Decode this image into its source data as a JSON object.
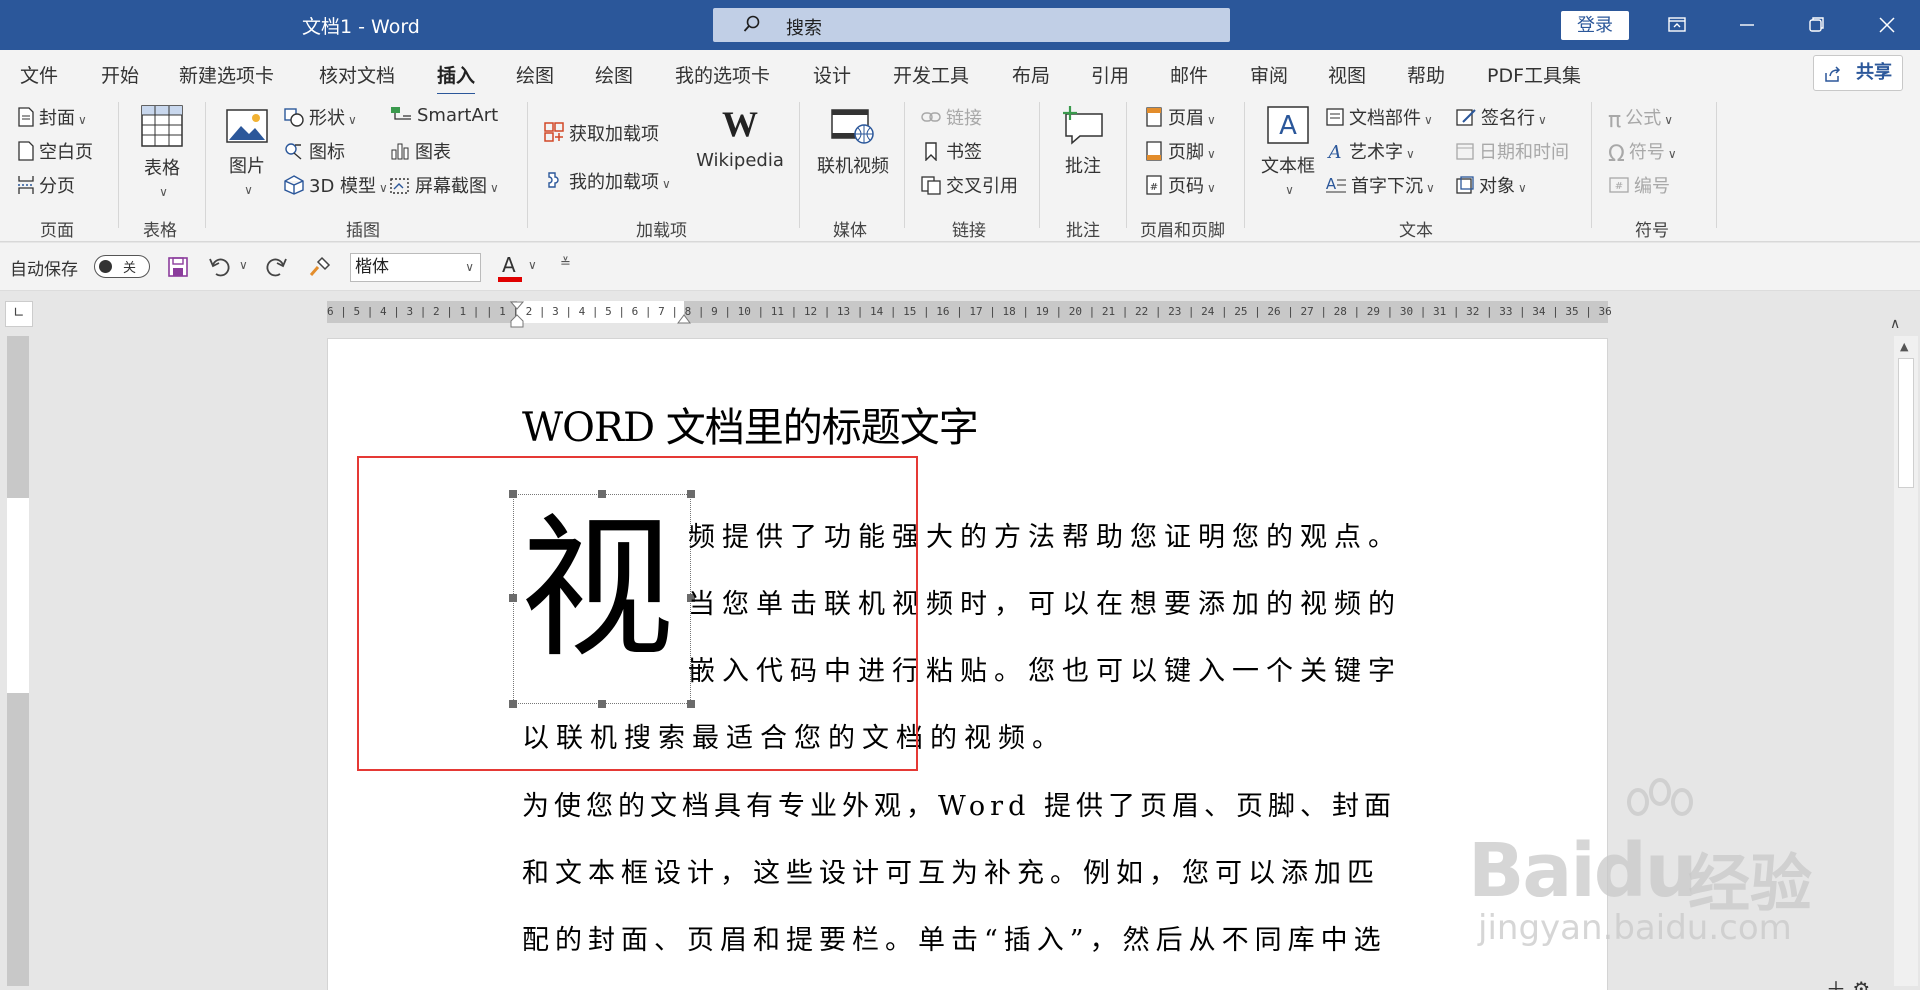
{
  "window": {
    "title": "文档1  -  Word",
    "search_placeholder": "搜索",
    "login_label": "登录"
  },
  "tabs": [
    "文件",
    "开始",
    "新建选项卡",
    "核对文档",
    "插入",
    "绘图",
    "绘图",
    "我的选项卡",
    "设计",
    "开发工具",
    "布局",
    "引用",
    "邮件",
    "审阅",
    "视图",
    "帮助",
    "PDF工具集"
  ],
  "active_tab": "插入",
  "share_label": "共享",
  "ribbon": {
    "page": {
      "cover": "封面",
      "blank": "空白页",
      "break": "分页",
      "label": "页面"
    },
    "table": {
      "btn": "表格",
      "label": "表格"
    },
    "illustrations": {
      "picture": "图片",
      "shapes": "形状",
      "icons": "图标",
      "model3d": "3D 模型",
      "smartart": "SmartArt",
      "chart": "图表",
      "screenshot": "屏幕截图",
      "label": "插图"
    },
    "addins": {
      "get": "获取加载项",
      "mine": "我的加载项",
      "wikipedia": "Wikipedia",
      "label": "加载项"
    },
    "media": {
      "online_video": "联机视频",
      "label": "媒体"
    },
    "links": {
      "link": "链接",
      "bookmark": "书签",
      "crossref": "交叉引用",
      "label": "链接"
    },
    "comments": {
      "comment": "批注",
      "label": "批注"
    },
    "header_footer": {
      "header": "页眉",
      "footer": "页脚",
      "page_number": "页码",
      "label": "页眉和页脚"
    },
    "text": {
      "textbox": "文本框",
      "quickparts": "文档部件",
      "wordart": "艺术字",
      "dropcap": "首字下沉",
      "signature": "签名行",
      "datetime": "日期和时间",
      "object": "对象",
      "label": "文本"
    },
    "symbols": {
      "equation": "公式",
      "symbol": "符号",
      "number": "编号",
      "label": "符号"
    }
  },
  "qat": {
    "autosave_label": "自动保存",
    "toggle_state": "关",
    "font_name": "楷体",
    "font_color": "#e00000"
  },
  "ruler": {
    "h_numbers": "6 | 5 | 4 | 3 | 2 | 1 |   | 1 | 2 | 3 | 4 | 5 |  6 | 7 | 8 | 9 | 10 | 11 | 12 | 13 | 14 | 15 | 16 | 17 | 18 | 19 | 20 | 21 | 22 | 23 | 24 | 25 | 26 | 27 | 28 | 29 | 30 | 31 | 32 | 33 | 34 | 35 | 36"
  },
  "document": {
    "heading": "WORD 文档里的标题文字",
    "dropcap_char": "视",
    "lines": [
      "频提供了功能强大的方法帮助您证明您的观点。",
      "当您单击联机视频时，可以在想要添加的视频的",
      "嵌入代码中进行粘贴。您也可以键入一个关键字",
      "以联机搜索最适合您的文档的视频。",
      "为使您的文档具有专业外观，Word 提供了页眉、页脚、封面",
      "和文本框设计，这些设计可互为补充。例如，您可以添加匹",
      "配的封面、页眉和提要栏。单击“插入”，然后从不同库中选"
    ]
  },
  "watermark": {
    "brand": "Bai",
    "brand2": "du",
    "cn": "经验",
    "sub": "jingyan.baidu.com"
  },
  "colors": {
    "titlebar": "#2b579a",
    "highlight_box": "#e53935"
  }
}
